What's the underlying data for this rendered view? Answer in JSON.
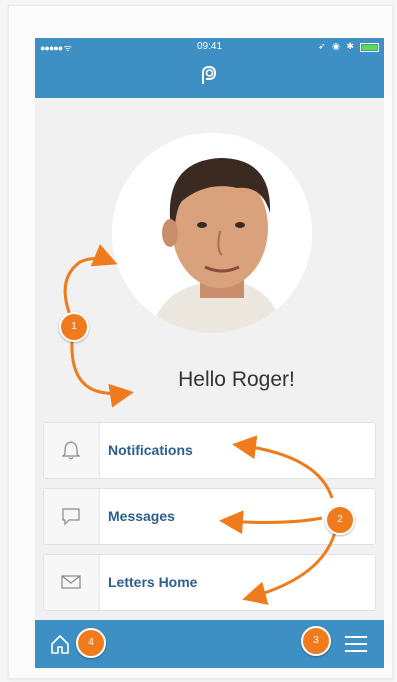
{
  "status_bar": {
    "signal": "●●●●● ᯤ",
    "time": "09:41",
    "icons": "➶ ◉ ✱"
  },
  "header": {
    "logo_icon": "app-logo-icon"
  },
  "greeting": "Hello Roger!",
  "menu": [
    {
      "label": "Notifications",
      "icon": "bell-icon"
    },
    {
      "label": "Messages",
      "icon": "chat-bubble-icon"
    },
    {
      "label": "Letters Home",
      "icon": "envelope-icon"
    }
  ],
  "bottom_nav": {
    "home_icon": "home-icon",
    "menu_icon": "hamburger-menu-icon"
  },
  "annotations": [
    "1",
    "2",
    "3",
    "4"
  ],
  "colors": {
    "primary": "#3d8fc4",
    "accent": "#f07b1d",
    "label": "#2e5f8c"
  }
}
